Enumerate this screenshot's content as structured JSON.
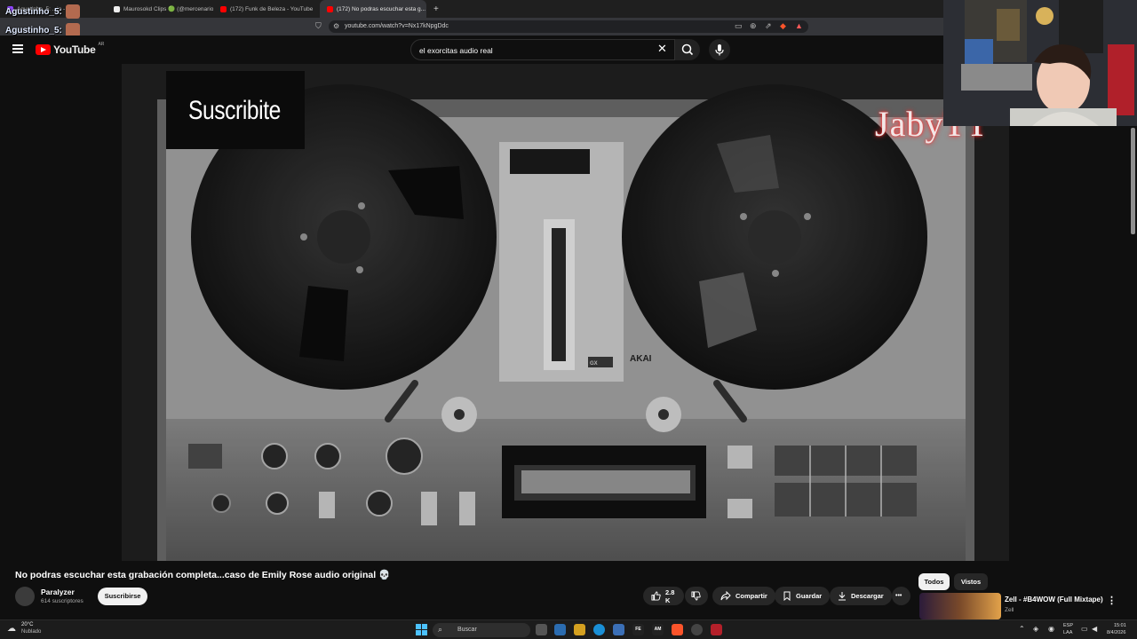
{
  "browser": {
    "tabs": [
      {
        "label": "Agustinho_5: ...io - Fu",
        "active": false
      },
      {
        "label": "Maurosokd Clips 🟢 (@mercenario...",
        "active": false
      },
      {
        "label": "(172) Funk de Beleza - YouTube",
        "active": false
      },
      {
        "label": "(172) No podras escuchar esta g...",
        "active": true
      }
    ],
    "new_tab": "+",
    "url": "youtube.com/watch?v=Nx17kNpgDdc"
  },
  "overlay": {
    "names": [
      "Agustinho_5:",
      "Agustinho_5:"
    ]
  },
  "youtube": {
    "logo_text": "YouTube",
    "country_code": "AR",
    "search_value": "el exorcitas audio real"
  },
  "video": {
    "overlay_subscribe": "Suscribite",
    "overlay_watermark": "JabyTT",
    "deck_brand": "AKAI",
    "deck_badge": "GX"
  },
  "below_video": {
    "title": "No podras escuchar esta grabación completa...caso de Emily Rose audio original 💀",
    "channel_name": "Paralyzer",
    "channel_subs": "614 suscriptores",
    "subscribe_label": "Suscribirse",
    "like_count": "2.8 K",
    "share_label": "Compartir",
    "save_label": "Guardar",
    "download_label": "Descargar",
    "more_label": "•••"
  },
  "sidebar": {
    "chips": [
      "Todos",
      "Vistos"
    ],
    "rec_title": "Zell - #B4WOW (Full Mixtape)",
    "rec_channel": "Zell",
    "rec_more": "⋮"
  },
  "taskbar": {
    "weather_temp": "20°C",
    "weather_desc": "Nublado",
    "search_label": "Buscar",
    "lang_line1": "ESP",
    "lang_line2": "LAA",
    "time": "15:01",
    "date": "8/4/2026",
    "apps": [
      "FE",
      "AM"
    ]
  },
  "colors": {
    "brand_red": "#ff0000",
    "page_bg": "#0f0f0f",
    "pill_bg": "#272727",
    "watermark_glow": "#ff2020"
  }
}
